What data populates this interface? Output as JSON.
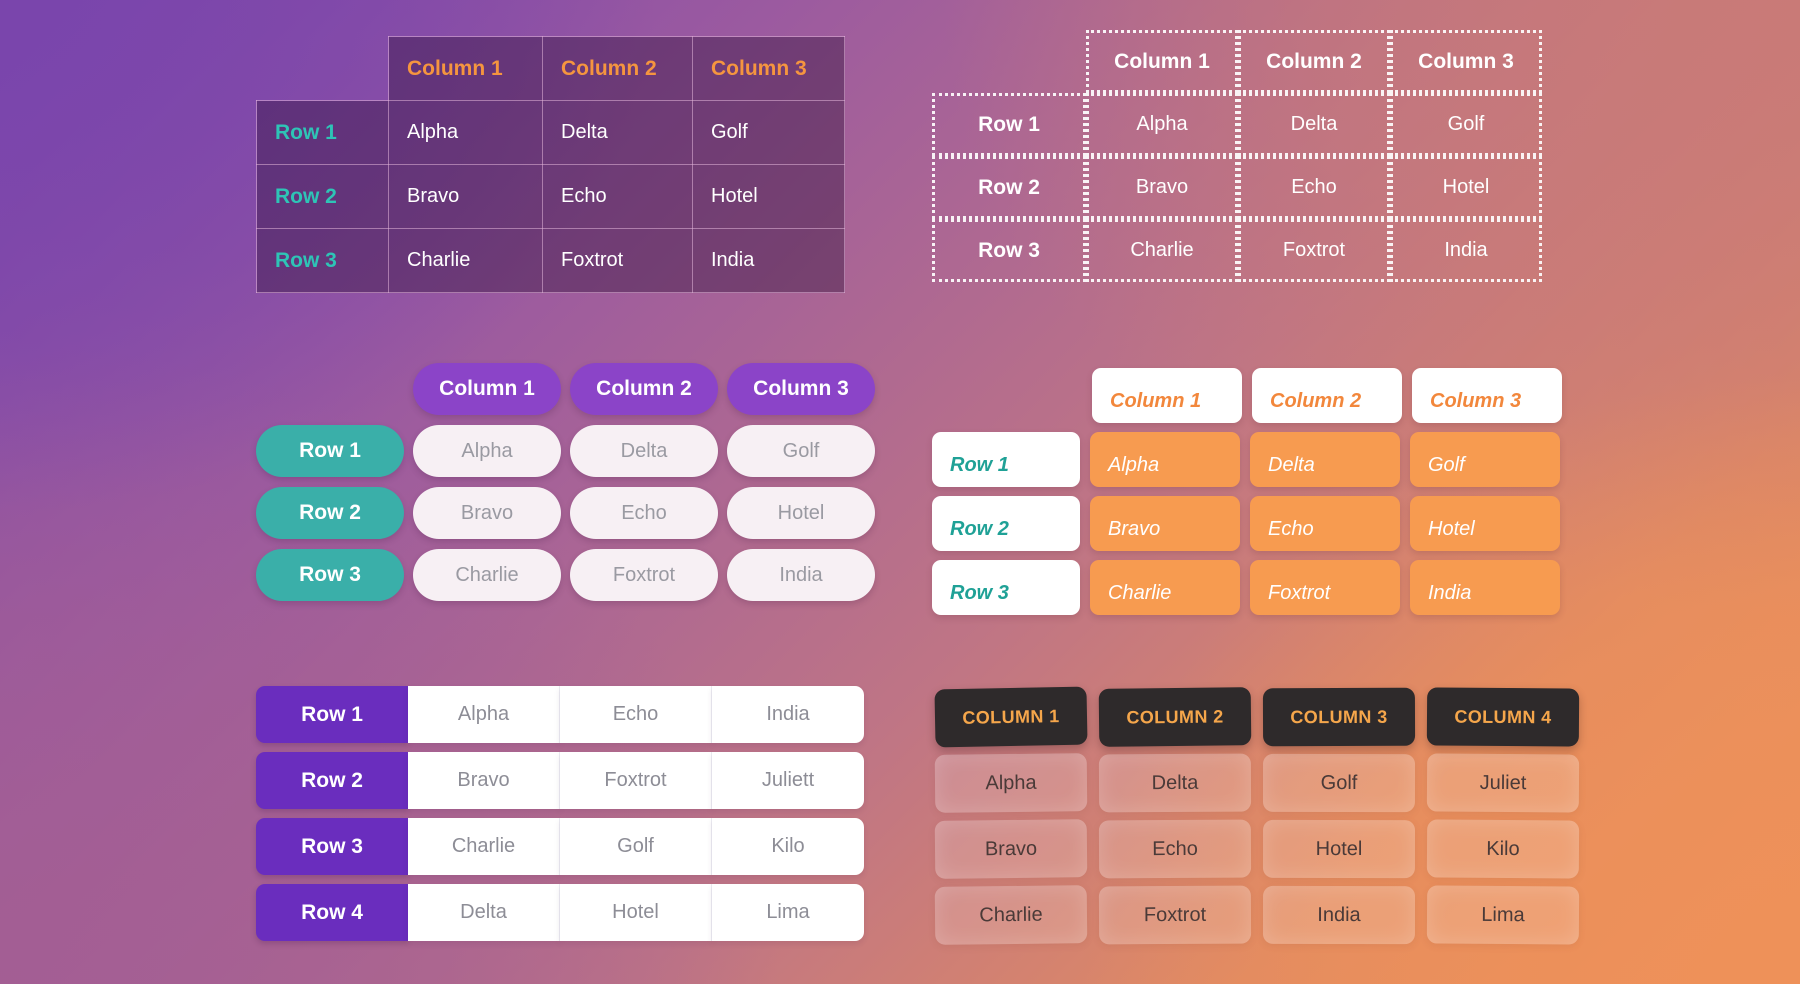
{
  "background": {
    "corner_top_left": "#7a45ac",
    "corner_top_right": "#c97a77",
    "corner_bottom_left": "#a35e93",
    "corner_bottom_right": "#ee9159"
  },
  "tables": {
    "grid_solid": {
      "corner_label": "",
      "columns": [
        "Column 1",
        "Column 2",
        "Column 3"
      ],
      "rows": [
        {
          "header": "Row 1",
          "cells": [
            "Alpha",
            "Delta",
            "Golf"
          ]
        },
        {
          "header": "Row 2",
          "cells": [
            "Bravo",
            "Echo",
            "Hotel"
          ]
        },
        {
          "header": "Row 3",
          "cells": [
            "Charlie",
            "Foxtrot",
            "India"
          ]
        }
      ],
      "header_color": "#f5953f",
      "row_header_color": "#2ec4b6"
    },
    "grid_dotted": {
      "columns": [
        "Column 1",
        "Column 2",
        "Column 3"
      ],
      "rows": [
        {
          "header": "Row 1",
          "cells": [
            "Alpha",
            "Delta",
            "Golf"
          ]
        },
        {
          "header": "Row 2",
          "cells": [
            "Bravo",
            "Echo",
            "Hotel"
          ]
        },
        {
          "header": "Row 3",
          "cells": [
            "Charlie",
            "Foxtrot",
            "India"
          ]
        }
      ],
      "border_color": "#ffffff"
    },
    "pills": {
      "columns": [
        "Column 1",
        "Column 2",
        "Column 3"
      ],
      "rows": [
        {
          "header": "Row 1",
          "cells": [
            "Alpha",
            "Delta",
            "Golf"
          ]
        },
        {
          "header": "Row 2",
          "cells": [
            "Bravo",
            "Echo",
            "Hotel"
          ]
        },
        {
          "header": "Row 3",
          "cells": [
            "Charlie",
            "Foxtrot",
            "India"
          ]
        }
      ],
      "header_bg": "#8b44c8",
      "row_header_bg": "#3aafa9",
      "cell_bg": "#f7f0f4"
    },
    "orange_cards": {
      "columns": [
        "Column 1",
        "Column 2",
        "Column 3"
      ],
      "rows": [
        {
          "header": "Row 1",
          "cells": [
            "Alpha",
            "Delta",
            "Golf"
          ]
        },
        {
          "header": "Row 2",
          "cells": [
            "Bravo",
            "Echo",
            "Hotel"
          ]
        },
        {
          "header": "Row 3",
          "cells": [
            "Charlie",
            "Foxtrot",
            "India"
          ]
        }
      ],
      "header_text_color": "#f2873c",
      "row_header_text_color": "#1fa196",
      "cell_bg": "#f79b50"
    },
    "row_bars": {
      "rows": [
        {
          "header": "Row 1",
          "cells": [
            "Alpha",
            "Echo",
            "India"
          ]
        },
        {
          "header": "Row 2",
          "cells": [
            "Bravo",
            "Foxtrot",
            "Juliett"
          ]
        },
        {
          "header": "Row 3",
          "cells": [
            "Charlie",
            "Golf",
            "Kilo"
          ]
        },
        {
          "header": "Row 4",
          "cells": [
            "Delta",
            "Hotel",
            "Lima"
          ]
        }
      ],
      "row_header_bg": "#6a2dbe",
      "cell_bg": "#ffffff"
    },
    "dark_header_cards": {
      "columns": [
        "COLUMN 1",
        "COLUMN 2",
        "COLUMN 3",
        "COLUMN 4"
      ],
      "rows": [
        [
          "Alpha",
          "Delta",
          "Golf",
          "Juliet"
        ],
        [
          "Bravo",
          "Echo",
          "Hotel",
          "Kilo"
        ],
        [
          "Charlie",
          "Foxtrot",
          "India",
          "Lima"
        ]
      ],
      "header_bg": "#2e2a2b",
      "header_text_color": "#f5a64b"
    }
  }
}
